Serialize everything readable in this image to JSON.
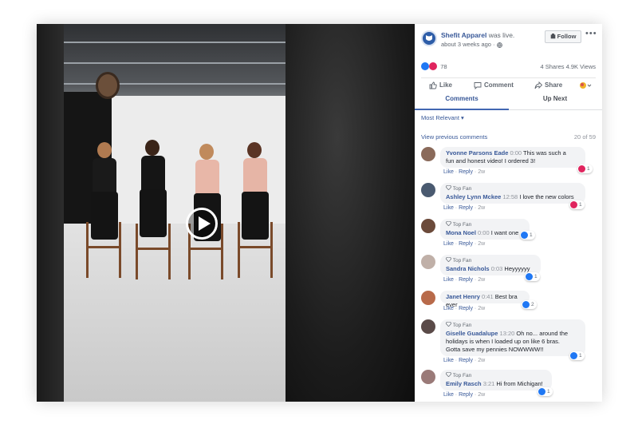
{
  "page": {
    "name": "Shefit Apparel",
    "status": "was live.",
    "time": "about 3 weeks ago ·",
    "follow_label": "Follow",
    "more_label": "•••"
  },
  "stats": {
    "reactions_count": "78",
    "shares_views": "4 Shares  4.9K Views"
  },
  "actions": {
    "like": "Like",
    "comment": "Comment",
    "share": "Share"
  },
  "tabs": {
    "comments": "Comments",
    "up_next": "Up Next"
  },
  "sort_label": "Most Relevant ▾",
  "previous_label": "View previous comments",
  "page_count": "20 of 59",
  "meta": {
    "like": "Like",
    "reply": "Reply",
    "age": "2w",
    "top_fan": "Top Fan"
  },
  "colors": {
    "brand": "#385898",
    "accent": "#4267b2",
    "heart": "#e0245e",
    "like": "#2078f4"
  },
  "comments": [
    {
      "name": "Yvonne Parsons Eade",
      "time": "0:00",
      "text": "This was such a",
      "text2": "fun and honest video! I ordered 3!",
      "react": "1",
      "react_type": "heart"
    },
    {
      "name": "Ashley Lynn Mckee",
      "time": "12:58",
      "text": "I love the new colors",
      "react": "1",
      "react_type": "heart"
    },
    {
      "name": "Mona Noel",
      "time": "0:00",
      "text": "I want one",
      "react": "1",
      "react_type": "like"
    },
    {
      "name": "Sandra Nichols",
      "time": "0:03",
      "text": "Heyyyyyy",
      "react": "1",
      "react_type": "like"
    },
    {
      "name": "Janet Henry",
      "time": "0:41",
      "text": "Best bra ever",
      "react": "2",
      "react_type": "like"
    },
    {
      "name": "Giselle Guadalupe",
      "time": "13:20",
      "text": "Oh no... around the",
      "text2": "holidays is when I loaded up on like 6 bras.",
      "text3": "Gotta save my pennies NOWWWW!!",
      "react": "1",
      "react_type": "like"
    },
    {
      "name": "Emily Rasch",
      "time": "3:21",
      "text": "Hi from Michigan!",
      "react": "1",
      "react_type": "like"
    }
  ]
}
